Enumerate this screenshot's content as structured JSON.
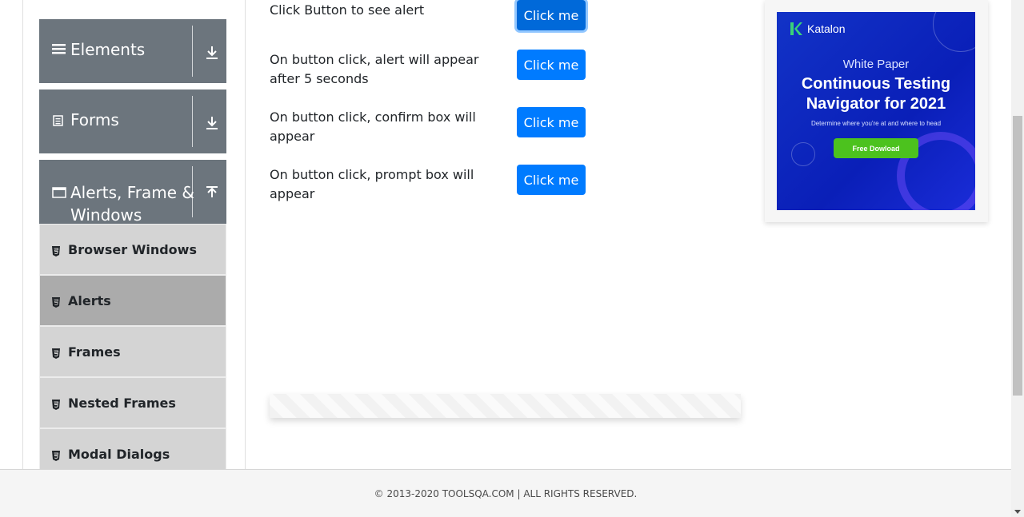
{
  "sidebar": {
    "groups": [
      {
        "label": "Elements",
        "icon": "menu-icon",
        "toggle_icon": "download-arrow-icon"
      },
      {
        "label": "Forms",
        "icon": "document-icon",
        "toggle_icon": "download-arrow-icon"
      },
      {
        "label": "Alerts, Frame & Windows",
        "line1": "Alerts, Frame &",
        "line2": "Windows",
        "icon": "window-icon",
        "toggle_icon": "upload-arrow-icon"
      }
    ],
    "items": [
      {
        "label": "Browser Windows",
        "active": false
      },
      {
        "label": "Alerts",
        "active": true
      },
      {
        "label": "Frames",
        "active": false
      },
      {
        "label": "Nested Frames",
        "active": false
      },
      {
        "label": "Modal Dialogs",
        "active": false
      }
    ]
  },
  "alerts": [
    {
      "text": "Click Button to see alert",
      "button": "Click me"
    },
    {
      "text": "On button click, alert will appear after 5 seconds",
      "button": "Click me"
    },
    {
      "text": "On button click, confirm box will appear",
      "button": "Click me"
    },
    {
      "text": "On button click, prompt box will appear",
      "button": "Click me"
    }
  ],
  "ad": {
    "brand": "Katalon",
    "kicker": "White Paper",
    "headline_line1": "Continuous Testing",
    "headline_line2": "Navigator for 2021",
    "sub": "Determine where you're at and where to head",
    "cta": "Free Dowload"
  },
  "footer": {
    "copyright": "© 2013-2020 TOOLSQA.COM | ALL RIGHTS RESERVED."
  },
  "colors": {
    "primary": "#007bff",
    "sidebar_header": "#6c757d",
    "item_bg": "#d4d4d4",
    "item_active": "#ababab"
  }
}
